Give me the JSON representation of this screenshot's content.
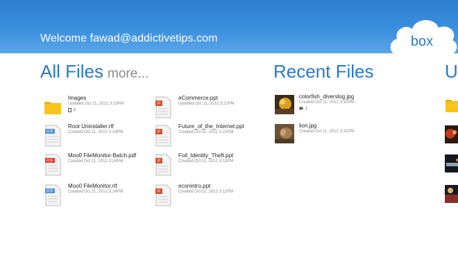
{
  "header": {
    "welcome": "Welcome  fawad@addictivetips.com",
    "logo": "box"
  },
  "all_files": {
    "title": "All Files",
    "more": "more...",
    "items": [
      {
        "name": "Images",
        "meta": "Updated Oct 11, 2012 3:23PM",
        "sub": "0",
        "icon": "folder-icon"
      },
      {
        "name": "Root Uninstaller.rtf",
        "meta": "Created Oct 11, 2012 3:24PM",
        "icon": "rtf-file-icon"
      },
      {
        "name": "Moo0 FileMonitor-Batch.pdf",
        "meta": "Created Oct 11, 2012 3:24PM",
        "icon": "pdf-file-icon"
      },
      {
        "name": "Moo0 FileMonitor.rtf",
        "meta": "Created Oct 11, 2012 3:24PM",
        "icon": "rtf-file-icon"
      },
      {
        "name": "eCommerce.ppt",
        "meta": "Updated Oct 11, 2012 3:22PM",
        "icon": "ppt-file-icon"
      },
      {
        "name": "Future_of_the_Internet.ppt",
        "meta": "Created Oct 11, 2012 3:22PM",
        "icon": "ppt-file-icon"
      },
      {
        "name": "Foil_Identity_Theft.ppt",
        "meta": "Created Oct 11, 2012 3:13PM",
        "icon": "ppt-file-icon"
      },
      {
        "name": "econintro.ppt",
        "meta": "Created Oct 11, 2012 3:12PM",
        "icon": "ppt-file-icon"
      }
    ]
  },
  "recent_files": {
    "title": "Recent Files",
    "items": [
      {
        "name": "colorfish_diverslog.jpg",
        "meta": "Created Oct 11, 2012 3:32PM",
        "sub": "1"
      },
      {
        "name": "lion.jpg",
        "meta": "Created Oct 11, 2012 3:31PM"
      }
    ]
  },
  "third_section": {
    "title": "U"
  },
  "colors": {
    "accent": "#2a78c6",
    "header": "#3b8fde",
    "folder": "#f7c51a"
  }
}
